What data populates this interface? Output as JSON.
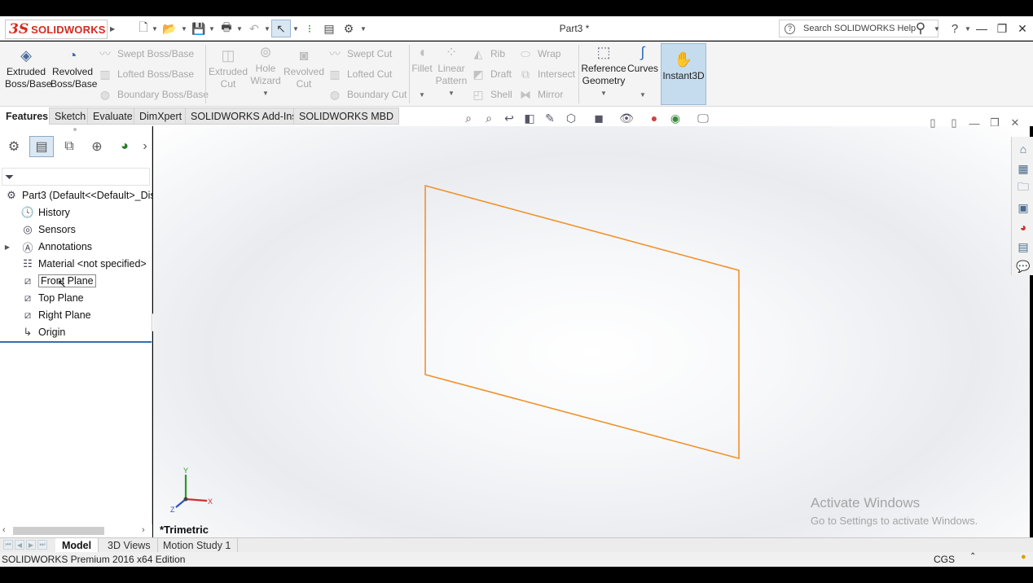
{
  "app": {
    "logo_ds": "3S",
    "logo_name": "SOLIDWORKS",
    "document_title": "Part3 *"
  },
  "search": {
    "placeholder": "Search SOLIDWORKS Help"
  },
  "ribbon": {
    "extruded_boss": [
      "Extruded",
      "Boss/Base"
    ],
    "revolved_boss": [
      "Revolved",
      "Boss/Base"
    ],
    "swept_boss": "Swept Boss/Base",
    "lofted_boss": "Lofted Boss/Base",
    "boundary_boss": "Boundary Boss/Base",
    "extruded_cut": [
      "Extruded",
      "Cut"
    ],
    "hole_wizard": [
      "Hole",
      "Wizard"
    ],
    "revolved_cut": [
      "Revolved",
      "Cut"
    ],
    "swept_cut": "Swept Cut",
    "lofted_cut": "Lofted Cut",
    "boundary_cut": "Boundary Cut",
    "fillet": "Fillet",
    "linear_pattern": [
      "Linear",
      "Pattern"
    ],
    "rib": "Rib",
    "draft": "Draft",
    "shell": "Shell",
    "wrap": "Wrap",
    "intersect": "Intersect",
    "mirror": "Mirror",
    "reference_geometry": [
      "Reference",
      "Geometry"
    ],
    "curves": "Curves",
    "instant3d": "Instant3D"
  },
  "command_tabs": [
    "Features",
    "Sketch",
    "Evaluate",
    "DimXpert",
    "SOLIDWORKS Add-Ins",
    "SOLIDWORKS MBD"
  ],
  "tree": {
    "root": "Part3  (Default<<Default>_Disp",
    "items": [
      {
        "label": "History",
        "icon": "history-icon"
      },
      {
        "label": "Sensors",
        "icon": "sensors-icon"
      },
      {
        "label": "Annotations",
        "icon": "annotations-icon"
      },
      {
        "label": "Material <not specified>",
        "icon": "material-icon"
      },
      {
        "label": "Front Plane",
        "icon": "plane-icon"
      },
      {
        "label": "Top Plane",
        "icon": "plane-icon"
      },
      {
        "label": "Right Plane",
        "icon": "plane-icon"
      },
      {
        "label": "Origin",
        "icon": "origin-icon"
      }
    ]
  },
  "viewport": {
    "view_name": "*Trimetric",
    "triad_y": "Y",
    "triad_x": "X",
    "triad_z": "Z",
    "watermark_title": "Activate Windows",
    "watermark_sub": "Go to Settings to activate Windows.",
    "plane_color": "#f0922b"
  },
  "bottom_tabs": [
    "Model",
    "3D Views",
    "Motion Study 1"
  ],
  "status": {
    "edition": "SOLIDWORKS Premium 2016 x64 Edition",
    "units": "CGS"
  }
}
